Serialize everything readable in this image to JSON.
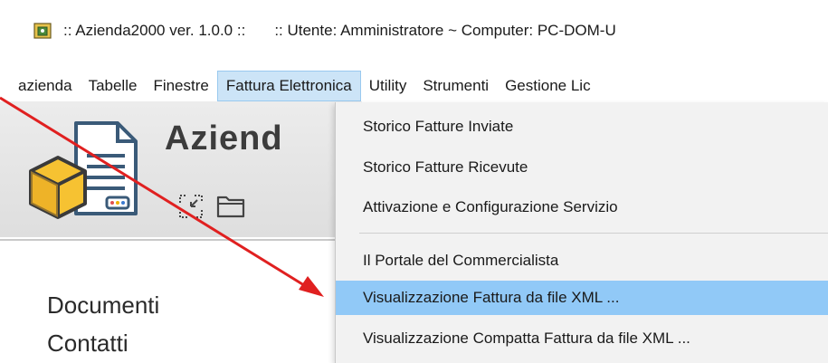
{
  "titlebar": {
    "app_title": ":: Azienda2000  ver. 1.0.0 ::",
    "user_info": ":: Utente: Amministratore ~ Computer: PC-DOM-U"
  },
  "menubar": {
    "items": [
      {
        "label": "azienda"
      },
      {
        "label": "Tabelle"
      },
      {
        "label": "Finestre"
      },
      {
        "label": "Fattura Elettronica"
      },
      {
        "label": "Utility"
      },
      {
        "label": "Strumenti"
      },
      {
        "label": "Gestione Lic"
      }
    ],
    "active_index": 3
  },
  "app": {
    "name": "Aziend",
    "nav": [
      {
        "label": "Documenti"
      },
      {
        "label": "Contatti"
      }
    ]
  },
  "dropdown": {
    "items": [
      {
        "label": "Storico Fatture Inviate"
      },
      {
        "label": "Storico Fatture Ricevute"
      },
      {
        "label": "Attivazione e Configurazione Servizio"
      },
      {
        "label": "Il Portale del Commercialista"
      },
      {
        "label": "Visualizzazione Fattura da file XML ..."
      },
      {
        "label": "Visualizzazione Compatta Fattura da file XML ..."
      }
    ],
    "highlighted_index": 4
  },
  "colors": {
    "menu_active_bg": "#cce4f7",
    "dropdown_highlight": "#91c9f7",
    "arrow": "#e02020"
  },
  "icons": [
    "app-icon",
    "document-icon",
    "box-icon",
    "collapse-icon",
    "folder-icon"
  ]
}
